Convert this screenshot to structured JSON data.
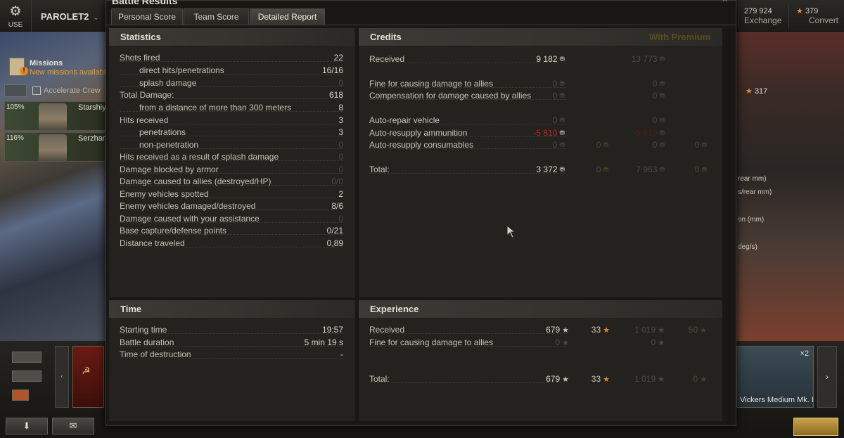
{
  "topbar": {
    "use_label": "USE",
    "player_name": "PAROLET2",
    "exchange_value": "279 924",
    "exchange_label": "Exchange",
    "convert_value": "379",
    "convert_label": "Convert"
  },
  "left_panel": {
    "missions_title": "Missions",
    "missions_sub": "New missions available",
    "accelerate_label": "Accelerate Crew",
    "crew": [
      {
        "pct": "105%",
        "name": "Starshiy"
      },
      {
        "pct": "116%",
        "name": "Serzhant"
      }
    ]
  },
  "right_panel": {
    "stat_value": "317",
    "lines": [
      "rear mm)",
      "s/rear mm)",
      "on (mm)",
      "deg/s)"
    ],
    "tank_name": "Vickers Medium Mk. I",
    "tank_badge": "×2"
  },
  "dialog": {
    "title": "Battle Results",
    "tabs": [
      "Personal Score",
      "Team Score",
      "Detailed Report"
    ],
    "active_tab": "Detailed Report"
  },
  "statistics": {
    "title": "Statistics",
    "rows": [
      {
        "label": "Shots fired",
        "value": "22",
        "indent": false,
        "dim": false
      },
      {
        "label": "direct hits/penetrations",
        "value": "16/16",
        "indent": true,
        "dim": false
      },
      {
        "label": "splash damage",
        "value": "0",
        "indent": true,
        "dim": true
      },
      {
        "label": "Total Damage:",
        "value": "618",
        "indent": false,
        "dim": false
      },
      {
        "label": "from a distance of more than 300 meters",
        "value": "8",
        "indent": true,
        "dim": false
      },
      {
        "label": "Hits received",
        "value": "3",
        "indent": false,
        "dim": false
      },
      {
        "label": "penetrations",
        "value": "3",
        "indent": true,
        "dim": false
      },
      {
        "label": "non-penetration",
        "value": "0",
        "indent": true,
        "dim": true
      },
      {
        "label": "Hits received as a result of splash damage",
        "value": "0",
        "indent": false,
        "dim": true
      },
      {
        "label": "Damage blocked by armor",
        "value": "0",
        "indent": false,
        "dim": true
      },
      {
        "label": "Damage caused to allies (destroyed/HP)",
        "value": "0/0",
        "indent": false,
        "dim": true
      },
      {
        "label": "Enemy vehicles spotted",
        "value": "2",
        "indent": false,
        "dim": false
      },
      {
        "label": "Enemy vehicles damaged/destroyed",
        "value": "8/6",
        "indent": false,
        "dim": false
      },
      {
        "label": "Damage caused with your assistance",
        "value": "0",
        "indent": false,
        "dim": true
      },
      {
        "label": "Base capture/defense points",
        "value": "0/21",
        "indent": false,
        "dim": false
      },
      {
        "label": "Distance traveled",
        "value": "0,89",
        "indent": false,
        "dim": false
      }
    ]
  },
  "credits": {
    "title": "Credits",
    "premium_label": "With Premium",
    "rows": [
      {
        "label": "Received",
        "base": "9 182",
        "base_dim": false,
        "base_gold": "",
        "prem": "13 773",
        "prem_gold": ""
      },
      {
        "label": "Fine for causing damage to allies",
        "base": "0",
        "base_dim": true,
        "base_gold": "",
        "prem": "0",
        "prem_gold": ""
      },
      {
        "label": "Compensation for damage caused by allies",
        "base": "0",
        "base_dim": true,
        "base_gold": "",
        "prem": "0",
        "prem_gold": ""
      },
      {
        "label": "Auto-repair vehicle",
        "base": "0",
        "base_dim": true,
        "base_gold": "",
        "prem": "0",
        "prem_gold": ""
      },
      {
        "label": "Auto-resupply ammunition",
        "base": "-5 810",
        "base_dim": false,
        "base_red": true,
        "base_gold": "",
        "prem": "-5 810",
        "prem_gold": ""
      },
      {
        "label": "Auto-resupply consumables",
        "base": "0",
        "base_dim": true,
        "base_gold": "0",
        "prem": "0",
        "prem_gold": "0"
      },
      {
        "label": "Total:",
        "base": "3 372",
        "base_dim": false,
        "base_gold": "0",
        "prem": "7 963",
        "prem_gold": "0"
      }
    ]
  },
  "time": {
    "title": "Time",
    "rows": [
      {
        "label": "Starting time",
        "value": "19:57"
      },
      {
        "label": "Battle duration",
        "value": "5 min 19 s"
      },
      {
        "label": "Time of destruction",
        "value": "-"
      }
    ]
  },
  "experience": {
    "title": "Experience",
    "rows": [
      {
        "label": "Received",
        "xp": "679",
        "fxp": "33",
        "prem_xp": "1 019",
        "prem_fxp": "50"
      },
      {
        "label": "Fine for causing damage to allies",
        "xp": "0",
        "fxp": "",
        "prem_xp": "0",
        "prem_fxp": ""
      },
      {
        "label": "Total:",
        "xp": "679",
        "fxp": "33",
        "prem_xp": "1 019",
        "prem_fxp": "0"
      }
    ]
  },
  "colors": {
    "accent_gold": "#a07a28",
    "free_xp_orange": "#e8861f",
    "negative_red": "#c4241a"
  }
}
